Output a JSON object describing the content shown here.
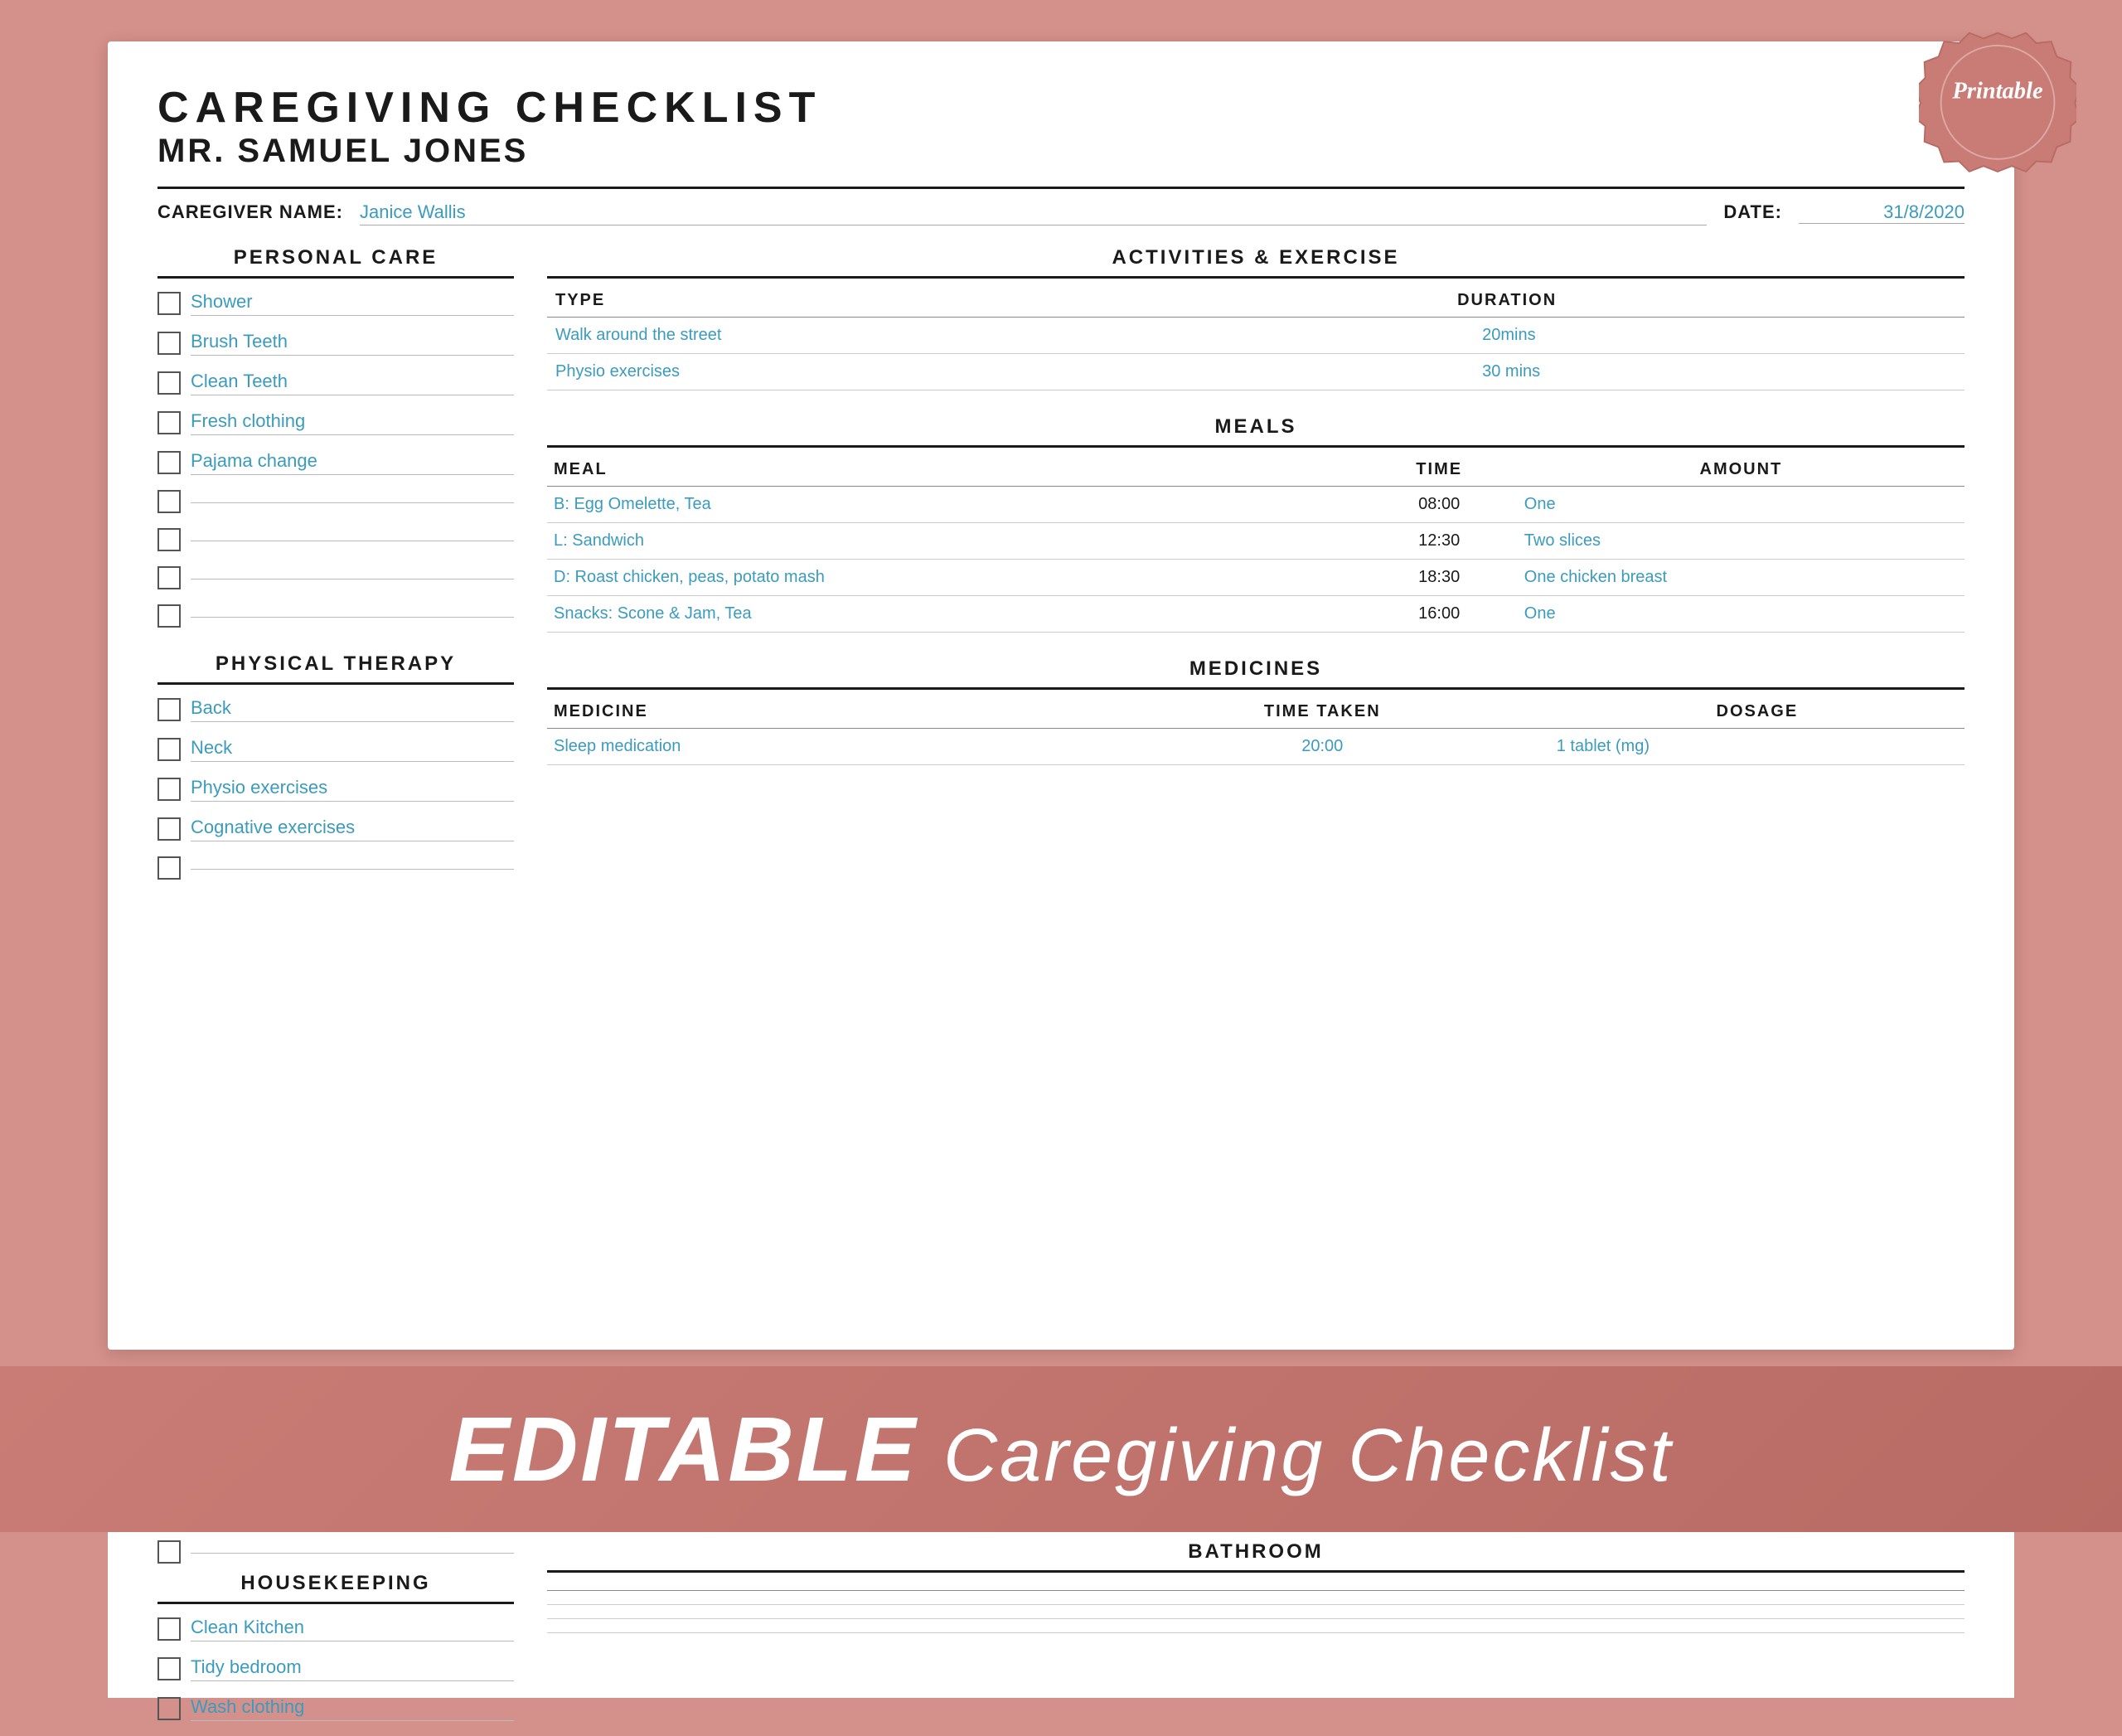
{
  "doc": {
    "title": "CAREGIVING CHECKLIST",
    "subtitle": "MR. SAMUEL JONES",
    "caregiver_label": "CAREGIVER NAME:",
    "caregiver_name": "Janice Wallis",
    "date_label": "DATE:",
    "date_value": "31/8/2020"
  },
  "personal_care": {
    "section_title": "PERSONAL CARE",
    "items": [
      "Shower",
      "Brush Teeth",
      "Clean Teeth",
      "Fresh clothing",
      "Pajama change",
      "",
      "",
      "",
      ""
    ]
  },
  "activities": {
    "section_title": "ACTIVITIES & EXERCISE",
    "col_type": "TYPE",
    "col_duration": "DURATION",
    "rows": [
      {
        "type": "Walk around the street",
        "duration": "20mins"
      },
      {
        "type": "Physio exercises",
        "duration": "30 mins"
      }
    ]
  },
  "meals": {
    "section_title": "MEALS",
    "col_meal": "MEAL",
    "col_time": "TIME",
    "col_amount": "AMOUNT",
    "rows": [
      {
        "meal": "B: Egg Omelette, Tea",
        "time": "08:00",
        "amount": "One"
      },
      {
        "meal": "L: Sandwich",
        "time": "12:30",
        "amount": "Two slices"
      },
      {
        "meal": "D: Roast chicken, peas, potato mash",
        "time": "18:30",
        "amount": "One chicken breast"
      },
      {
        "meal": "Snacks: Scone & Jam, Tea",
        "time": "16:00",
        "amount": "One"
      }
    ]
  },
  "medicines": {
    "section_title": "MEDICINES",
    "col_medicine": "MEDICINE",
    "col_time": "TIME TAKEN",
    "col_dosage": "DOSAGE",
    "rows": [
      {
        "medicine": "Sleep medication",
        "time": "20:00",
        "dosage": "1 tablet (mg)"
      }
    ]
  },
  "physical_therapy": {
    "section_title": "PHYSICAL THERAPY",
    "items": [
      "Back",
      "Neck",
      "Physio exercises",
      "Cognative exercises",
      ""
    ]
  },
  "housekeeping": {
    "section_title": "HOUSEKEEPING",
    "items": [
      "Clean Kitchen",
      "Tidy bedroom",
      "Wash clothing"
    ]
  },
  "bathroom": {
    "section_title": "BATHROOM",
    "cols": [
      "",
      "",
      ""
    ],
    "rows": [
      [
        "",
        "",
        ""
      ],
      [
        "",
        "",
        ""
      ],
      [
        "",
        "",
        ""
      ]
    ]
  },
  "banner": {
    "text_editable": "EDITABLE",
    "text_rest": " Caregiving Checklist"
  },
  "badge": {
    "text": "Printable"
  }
}
